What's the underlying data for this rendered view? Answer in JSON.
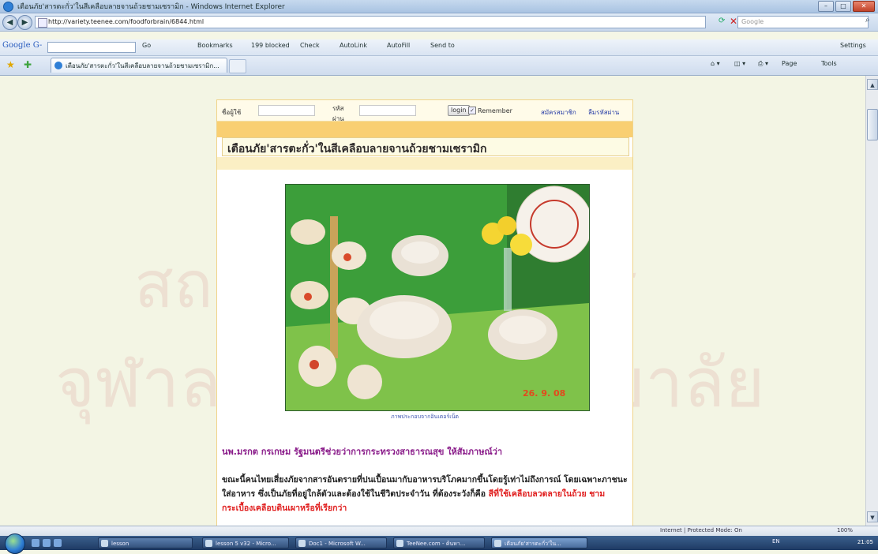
{
  "window": {
    "title": "เตือนภัย'สารตะกั่ว'ในสีเคลือบลายจานถ้วยชามเซรามิก - Windows Internet Explorer",
    "minimize": "–",
    "maximize": "□",
    "close": "✕"
  },
  "address": {
    "url": "http://variety.teenee.com/foodforbrain/6844.html",
    "search_placeholder": "Google"
  },
  "google_toolbar": {
    "logo": "Google G-",
    "go": "Go",
    "bookmarks": "Bookmarks",
    "blocked": "199 blocked",
    "check": "Check",
    "autolink": "AutoLink",
    "autofill": "AutoFill",
    "send_to": "Send to",
    "settings": "Settings"
  },
  "tabs": [
    {
      "label": "เตือนภัย'สารตะกั่ว'ในสีเคลือบลายจานถ้วยชามเซรามิก..."
    }
  ],
  "command_bar": {
    "page": "Page",
    "tools": "Tools"
  },
  "login": {
    "username_label": "ชื่อผู้ใช้",
    "password_label": "รหัสผ่าน",
    "login_button": "login",
    "remember_label": "Remember",
    "register_link": "สมัครสมาชิก",
    "forgot_link": "ลืมรหัสผ่าน"
  },
  "article": {
    "headline": "เตือนภัย'สารตะกั่ว'ในสีเคลือบลายจานถ้วยชามเซรามิก",
    "photo_caption": "ภาพประกอบจากอินเตอร์เน็ต",
    "author": "นพ.มรกต กรเกษม รัฐมนตรีช่วยว่าการกระทรวงสาธารณสุข ให้สัมภาษณ์ว่า",
    "para_normal": "ขณะนี้คนไทยเสี่ยงภัยจากสารอันตรายที่ปนเปื้อนมากับอาหารบริโภคมากขึ้นโดยรู้เท่าไม่ถึงการณ์ โดยเฉพาะภาชนะใส่อาหาร ซึ่งเป็นภัยที่อยู่ใกล้ตัวและต้องใช้ในชีวิตประจำวัน ที่ต้องระวังก็คือ ",
    "para_red": "สีที่ใช้เคลือบลวดลายในถ้วย ชาม กระเบื้องเคลือบดินเผาหรือที่เรียกว่า"
  },
  "watermark": {
    "line1": "สถาบันวิทยบริการ",
    "line2": "จุฬาลงกรณ์มหาวิทยาลัย"
  },
  "status": {
    "zone": "Internet | Protected Mode: On",
    "zoom": "100%"
  },
  "taskbar": {
    "tasks": [
      {
        "label": "lesson"
      },
      {
        "label": "lesson 5 v32 - Micro..."
      },
      {
        "label": "Doc1 - Microsoft W..."
      },
      {
        "label": "TeeNee.com - ค้นหา..."
      },
      {
        "label": "เตือนภัย'สารตะกั่ว'ใน..."
      }
    ],
    "tray": "EN",
    "clock": "21:05"
  },
  "colors": {
    "page_bg": "#f3f5e4",
    "accent_orange": "#f9cf72",
    "author_purple": "#8a1c8a",
    "warning_red": "#e01f1f"
  }
}
